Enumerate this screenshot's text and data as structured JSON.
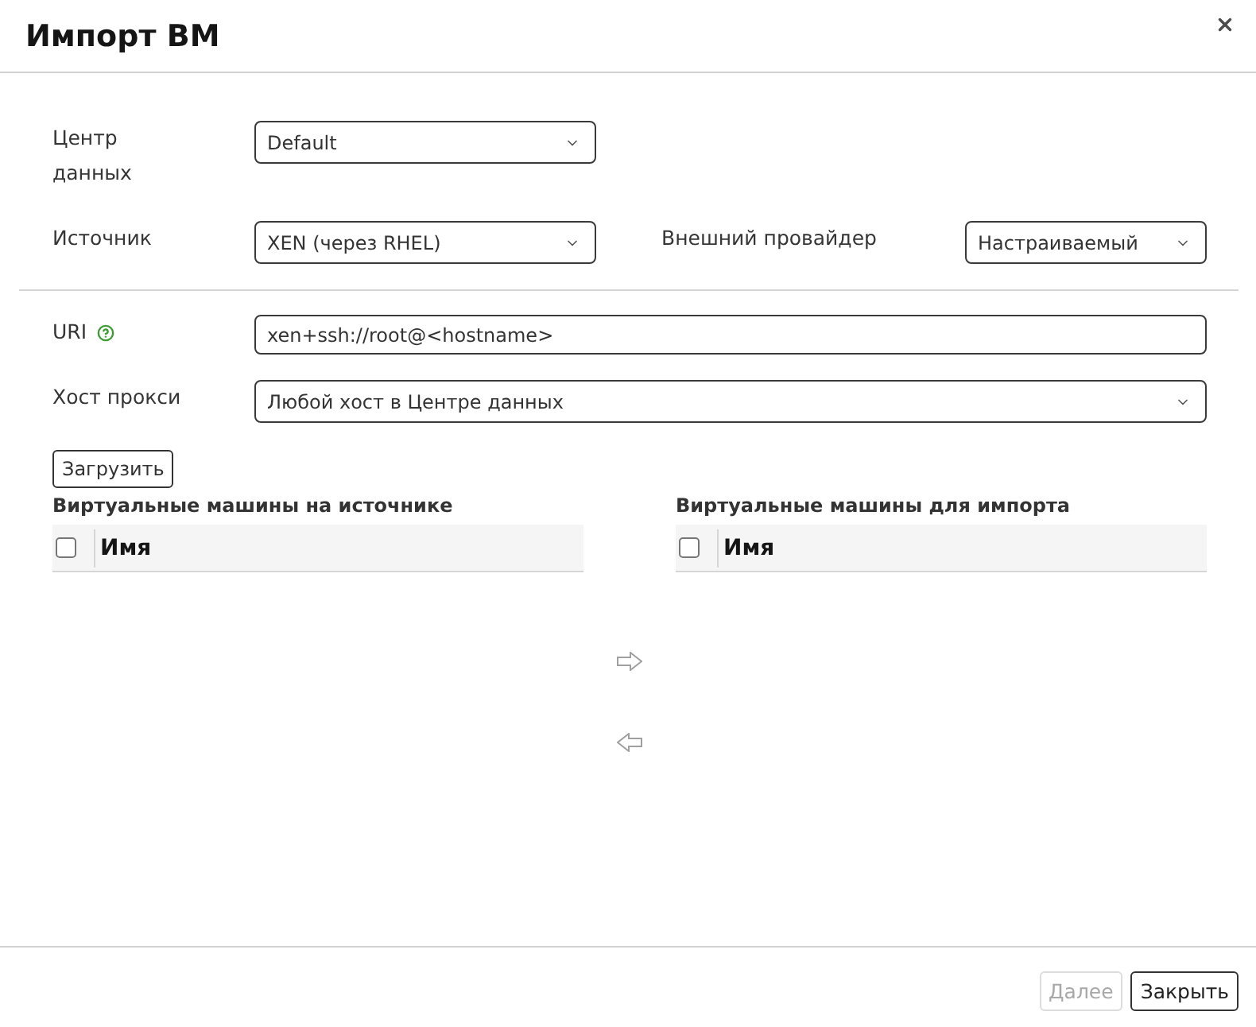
{
  "dialog": {
    "title": "Импорт ВМ"
  },
  "sections": [
    {
      "kind": "columns",
      "rows": [
        {
          "fields": [
            {
              "kind": "select",
              "label": "Центр данных",
              "value": "Default",
              "help": false
            }
          ]
        },
        {
          "fields": [
            {
              "kind": "select",
              "label": "Источник",
              "value": "XEN (через RHEL)",
              "help": false
            },
            {
              "kind": "select",
              "label": "Внешний провайдер",
              "value": "Настраиваемый",
              "help": false
            }
          ]
        }
      ]
    },
    {
      "kind": "full",
      "rows": [
        {
          "fields": [
            {
              "kind": "input",
              "label": "URI",
              "value": "xen+ssh://root@<hostname>",
              "help": true
            }
          ]
        },
        {
          "fields": [
            {
              "kind": "select",
              "label": "Хост прокси",
              "value": "Любой хост в Центре данных",
              "help": false
            }
          ]
        }
      ]
    }
  ],
  "load_button": {
    "label": "Загрузить"
  },
  "vm_lists": [
    {
      "title": "Виртуальные машины на источнике",
      "select_all_checked": false,
      "columns": [
        "Имя"
      ]
    },
    {
      "title": "Виртуальные машины для импорта",
      "select_all_checked": false,
      "columns": [
        "Имя"
      ]
    }
  ],
  "footer_buttons": [
    {
      "label": "Далее",
      "disabled": true
    },
    {
      "label": "Закрыть",
      "disabled": false
    }
  ]
}
